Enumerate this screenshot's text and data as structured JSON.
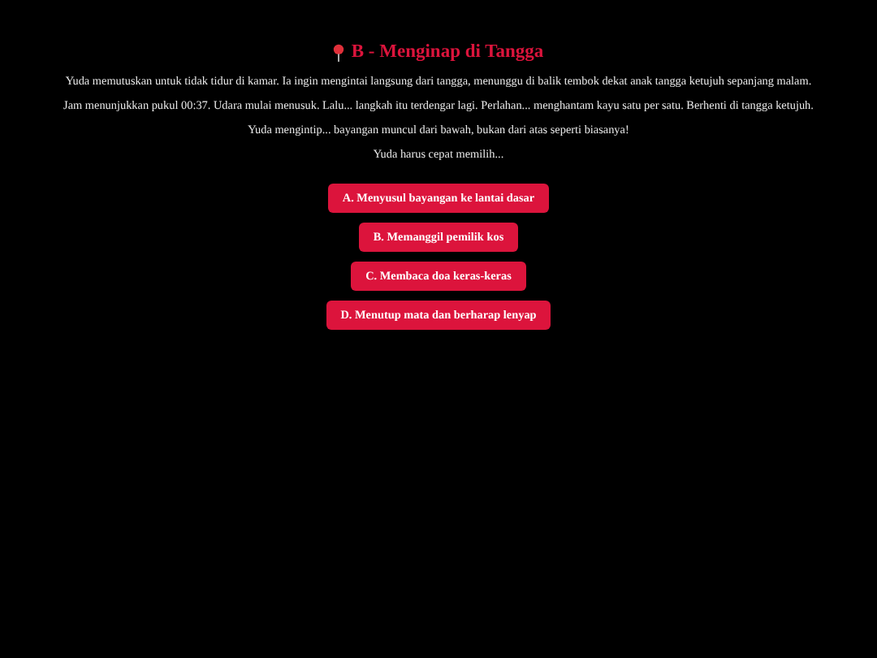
{
  "title": "B - Menginap di Tangga",
  "paragraphs": [
    "Yuda memutuskan untuk tidak tidur di kamar. Ia ingin mengintai langsung dari tangga, menunggu di balik tembok dekat anak tangga ketujuh sepanjang malam.",
    "Jam menunjukkan pukul 00:37. Udara mulai menusuk. Lalu... langkah itu terdengar lagi. Perlahan... menghantam kayu satu per satu. Berhenti di tangga ketujuh.",
    "Yuda mengintip... bayangan muncul dari bawah, bukan dari atas seperti biasanya!",
    "Yuda harus cepat memilih..."
  ],
  "choices": [
    "A. Menyusul bayangan ke lantai dasar",
    "B. Memanggil pemilik kos",
    "C. Membaca doa keras-keras",
    "D. Menutup mata dan berharap lenyap"
  ]
}
